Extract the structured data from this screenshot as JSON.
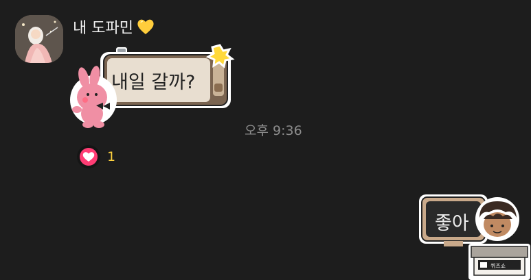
{
  "chat": {
    "sender_name": "내 도파민",
    "sender_emoji_icon": "yellow-heart-icon",
    "incoming_message": "내일 갈까?",
    "timestamp": "오후 9:36",
    "reaction": {
      "icon": "heart-reaction-icon",
      "count": "1"
    },
    "outgoing_message": "좋아",
    "sticker_sign_text": "퀴즈쇼"
  },
  "colors": {
    "background": "#1d1d1d",
    "incoming_bubble": "#e8ded0",
    "bubble_frame": "#7a6450",
    "outgoing_bubble": "#2a2a2a",
    "reaction_heart": "#ff3d74",
    "reaction_count": "#ffd23f",
    "timestamp": "#8c8c8c"
  }
}
